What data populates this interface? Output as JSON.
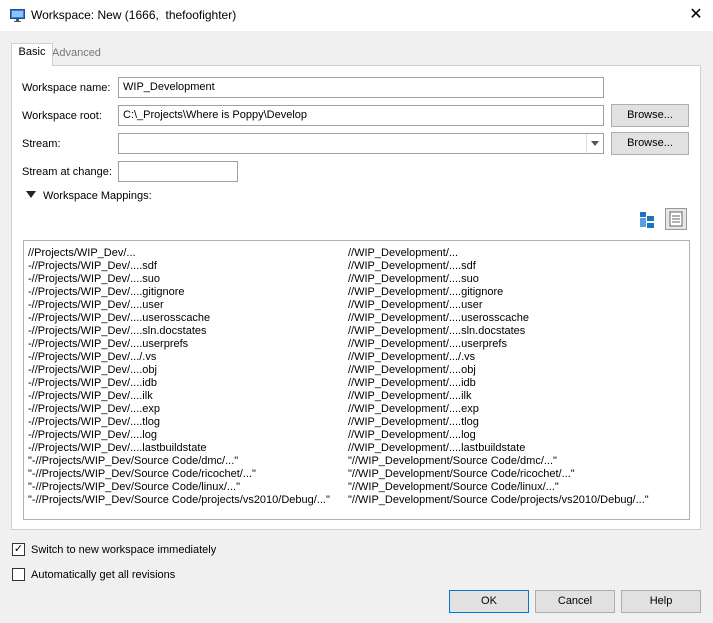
{
  "window": {
    "title": "Workspace: New (1666,  thefoofighter)",
    "close_glyph": "✕"
  },
  "tabs": [
    {
      "label": "Basic",
      "active": true
    },
    {
      "label": "Advanced",
      "active": false
    }
  ],
  "form": {
    "workspace_name_label": "Workspace name:",
    "workspace_name_value": "WIP_Development",
    "workspace_root_label": "Workspace root:",
    "workspace_root_value": "C:\\_Projects\\Where is Poppy\\Develop",
    "stream_label": "Stream:",
    "stream_value": "",
    "stream_at_change_label": "Stream at change:",
    "stream_at_change_value": "",
    "browse_label": "Browse..."
  },
  "mappings": {
    "section_label": "Workspace Mappings:",
    "rows": [
      {
        "depot": "//Projects/WIP_Dev/...",
        "client": "//WIP_Development/..."
      },
      {
        "depot": "-//Projects/WIP_Dev/....sdf",
        "client": "//WIP_Development/....sdf"
      },
      {
        "depot": "-//Projects/WIP_Dev/....suo",
        "client": "//WIP_Development/....suo"
      },
      {
        "depot": "-//Projects/WIP_Dev/....gitignore",
        "client": "//WIP_Development/....gitignore"
      },
      {
        "depot": "-//Projects/WIP_Dev/....user",
        "client": "//WIP_Development/....user"
      },
      {
        "depot": "-//Projects/WIP_Dev/....userosscache",
        "client": "//WIP_Development/....userosscache"
      },
      {
        "depot": "-//Projects/WIP_Dev/....sln.docstates",
        "client": "//WIP_Development/....sln.docstates"
      },
      {
        "depot": "-//Projects/WIP_Dev/....userprefs",
        "client": "//WIP_Development/....userprefs"
      },
      {
        "depot": "-//Projects/WIP_Dev/.../.vs",
        "client": "//WIP_Development/.../.vs"
      },
      {
        "depot": "-//Projects/WIP_Dev/....obj",
        "client": "//WIP_Development/....obj"
      },
      {
        "depot": "-//Projects/WIP_Dev/....idb",
        "client": "//WIP_Development/....idb"
      },
      {
        "depot": "-//Projects/WIP_Dev/....ilk",
        "client": "//WIP_Development/....ilk"
      },
      {
        "depot": "-//Projects/WIP_Dev/....exp",
        "client": "//WIP_Development/....exp"
      },
      {
        "depot": "-//Projects/WIP_Dev/....tlog",
        "client": "//WIP_Development/....tlog"
      },
      {
        "depot": "-//Projects/WIP_Dev/....log",
        "client": "//WIP_Development/....log"
      },
      {
        "depot": "-//Projects/WIP_Dev/....lastbuildstate",
        "client": "//WIP_Development/....lastbuildstate"
      },
      {
        "depot": "\"-//Projects/WIP_Dev/Source Code/dmc/...\"",
        "client": "\"//WIP_Development/Source Code/dmc/...\""
      },
      {
        "depot": "\"-//Projects/WIP_Dev/Source Code/ricochet/...\"",
        "client": "\"//WIP_Development/Source Code/ricochet/...\""
      },
      {
        "depot": "\"-//Projects/WIP_Dev/Source Code/linux/...\"",
        "client": "\"//WIP_Development/Source Code/linux/...\""
      },
      {
        "depot": "\"-//Projects/WIP_Dev/Source Code/projects/vs2010/Debug/...\"",
        "client": "\"//WIP_Development/Source Code/projects/vs2010/Debug/...\""
      }
    ]
  },
  "options": {
    "switch_label": "Switch to new workspace immediately",
    "switch_checked": true,
    "auto_get_label": "Automatically get all revisions",
    "auto_get_checked": false,
    "check_glyph": "✓"
  },
  "buttons": {
    "ok": "OK",
    "cancel": "Cancel",
    "help": "Help"
  },
  "colors": {
    "accent_border": "#0078d7",
    "tree_icon": "#1e73be"
  }
}
